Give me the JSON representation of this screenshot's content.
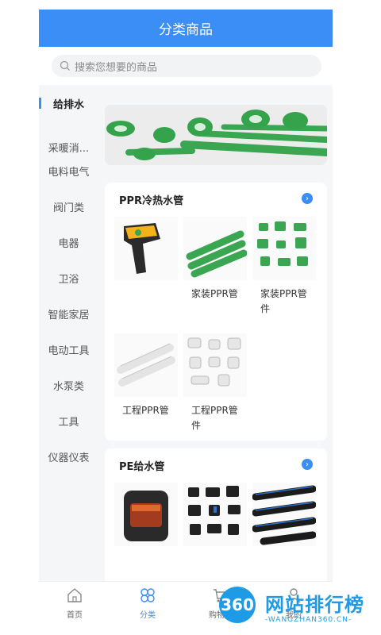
{
  "header": {
    "title": "分类商品"
  },
  "search": {
    "placeholder": "搜索您想要的商品"
  },
  "sidebar": {
    "items": [
      {
        "label": "给排水",
        "active": true
      },
      {
        "label": "采暖消..."
      },
      {
        "label": "电料电气"
      },
      {
        "label": "阀门类"
      },
      {
        "label": "电器"
      },
      {
        "label": "卫浴"
      },
      {
        "label": "智能家居"
      },
      {
        "label": "电动工具"
      },
      {
        "label": "水泵类"
      },
      {
        "label": "工具"
      },
      {
        "label": "仪器仪表"
      }
    ]
  },
  "sections": [
    {
      "title": "PPR冷热水管",
      "products": [
        {
          "name": "",
          "icon": "infrared-thermometer"
        },
        {
          "name": "家装PPR管",
          "icon": "green-pipes"
        },
        {
          "name": "家装PPR管件",
          "icon": "green-fittings"
        },
        {
          "name": "工程PPR管",
          "icon": "white-pipes"
        },
        {
          "name": "工程PPR管件",
          "icon": "white-fittings"
        }
      ]
    },
    {
      "title": "PE给水管",
      "products": [
        {
          "name": "",
          "icon": "air-fryer"
        },
        {
          "name": "",
          "icon": "black-fittings"
        },
        {
          "name": "",
          "icon": "black-pipes"
        }
      ]
    }
  ],
  "tabbar": {
    "items": [
      {
        "label": "首页"
      },
      {
        "label": "分类",
        "active": true
      },
      {
        "label": "购物车"
      },
      {
        "label": "我的"
      }
    ]
  },
  "watermark": {
    "main": "网站排行榜",
    "sub": "-WANGZHAN360.CN-",
    "badge": "360"
  },
  "colors": {
    "primary": "#3a8ef6",
    "watermark": "#1f9be6"
  }
}
